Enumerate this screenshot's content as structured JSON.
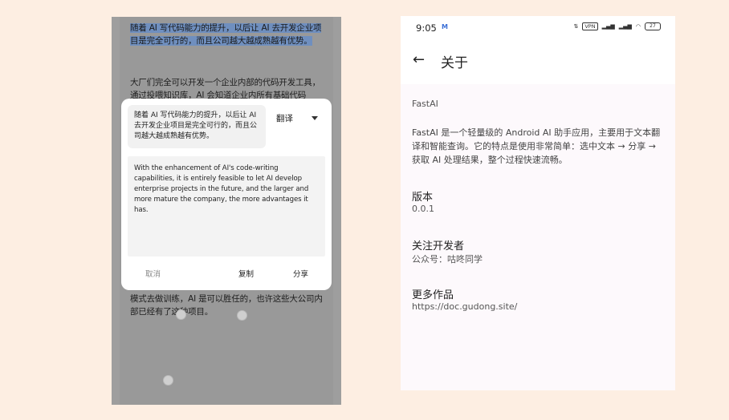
{
  "left_screen": {
    "doc": {
      "para1": "随着 AI 写代码能力的提升，以后让 AI 去开发企业项目是完全可行的，而且公司越大越成熟越有优势。",
      "para2": "大厂们完全可以开发一个企业内部的代码开发工具，通过投喂知识库，AI 会知道企业内所有基础代码",
      "para3": "模式去做训练，AI 是可以胜任的，也许这些大公司内部已经有了这种项目。"
    },
    "dialog": {
      "source_text": "随着 AI 写代码能力的提升，以后让 AI 去开发企业项目是完全可行的，而且公司越大越成熟越有优势。",
      "mode": "翻译",
      "result_text": "With the enhancement of AI's code-writing capabilities, it is entirely feasible to let AI develop enterprise projects in the future, and the larger and more mature the company, the more advantages it has.",
      "cancel": "取消",
      "copy": "复制",
      "share": "分享"
    }
  },
  "right_screen": {
    "status": {
      "time": "9:05",
      "carrier_icon": "M",
      "network_label": "VPN",
      "battery": "27"
    },
    "header": {
      "title": "关于"
    },
    "app_name": "FastAI",
    "description": "FastAI 是一个轻量级的 Android AI 助手应用，主要用于文本翻译和智能查询。它的特点是使用非常简单：选中文本 → 分享 → 获取 AI 处理结果，整个过程快速流畅。",
    "sections": [
      {
        "title": "版本",
        "value": "0.0.1"
      },
      {
        "title": "关注开发者",
        "value": "公众号：咕咚同学"
      },
      {
        "title": "更多作品",
        "value": "https://doc.gudong.site/"
      }
    ]
  }
}
